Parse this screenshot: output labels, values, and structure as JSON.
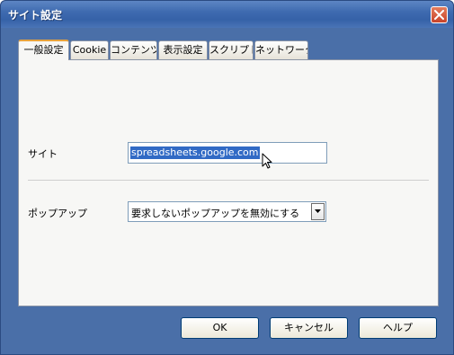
{
  "window": {
    "title": "サイト設定"
  },
  "tabs": [
    {
      "label": "一般設定",
      "active": true
    },
    {
      "label": "Cookie",
      "active": false
    },
    {
      "label": "コンテンツ",
      "active": false
    },
    {
      "label": "表示設定",
      "active": false
    },
    {
      "label": "スクリプト",
      "active": false
    },
    {
      "label": "ネットワーク",
      "active": false
    }
  ],
  "form": {
    "site_label": "サイト",
    "site_value": "spreadsheets.google.com",
    "popup_label": "ポップアップ",
    "popup_value": "要求しないポップアップを無効にする"
  },
  "buttons": {
    "ok": "OK",
    "cancel": "キャンセル",
    "help": "ヘルプ"
  },
  "colors": {
    "titlebar": "#3f6bb0",
    "selection": "#316ac5",
    "active_tab_accent": "#e8a33c",
    "close_button": "#c8432a"
  },
  "icons": [
    "close-icon",
    "dropdown-arrow-icon",
    "mouse-cursor-icon"
  ]
}
